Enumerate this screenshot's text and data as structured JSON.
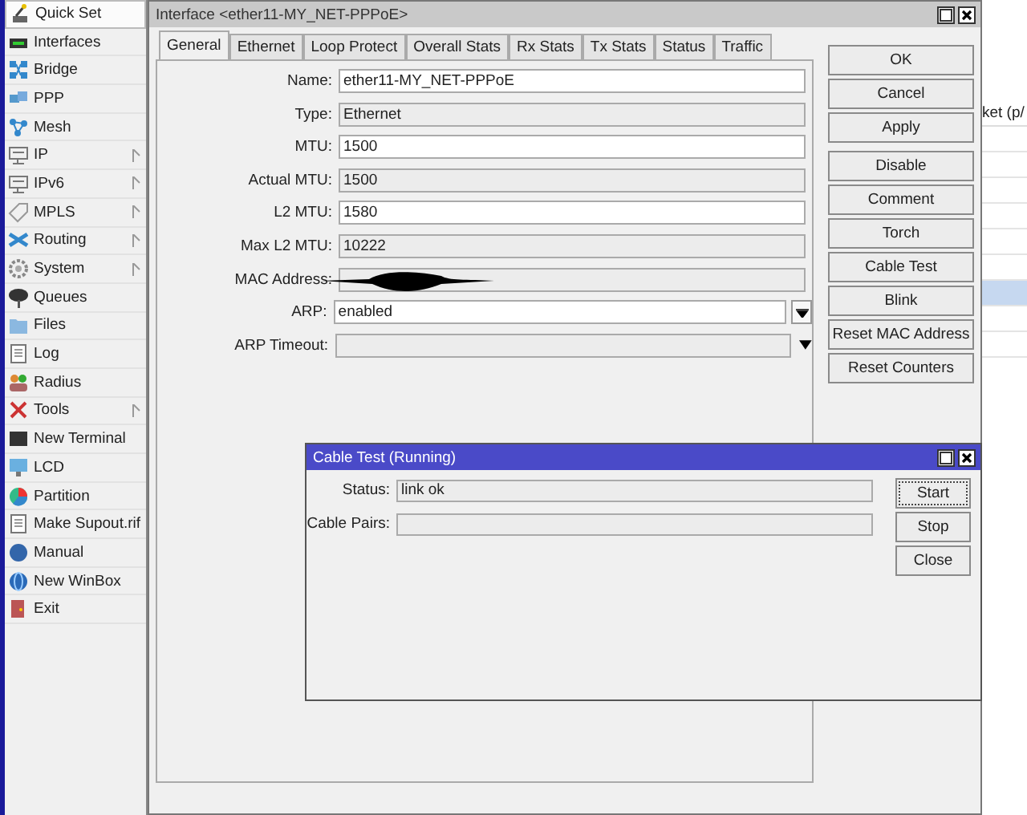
{
  "sidebar": {
    "items": [
      {
        "label": "Quick Set",
        "submenu": false,
        "selected": true
      },
      {
        "label": "Interfaces",
        "submenu": false,
        "selected": false
      },
      {
        "label": "Bridge",
        "submenu": false,
        "selected": false
      },
      {
        "label": "PPP",
        "submenu": false,
        "selected": false
      },
      {
        "label": "Mesh",
        "submenu": false,
        "selected": false
      },
      {
        "label": "IP",
        "submenu": true,
        "selected": false
      },
      {
        "label": "IPv6",
        "submenu": true,
        "selected": false
      },
      {
        "label": "MPLS",
        "submenu": true,
        "selected": false
      },
      {
        "label": "Routing",
        "submenu": true,
        "selected": false
      },
      {
        "label": "System",
        "submenu": true,
        "selected": false
      },
      {
        "label": "Queues",
        "submenu": false,
        "selected": false
      },
      {
        "label": "Files",
        "submenu": false,
        "selected": false
      },
      {
        "label": "Log",
        "submenu": false,
        "selected": false
      },
      {
        "label": "Radius",
        "submenu": false,
        "selected": false
      },
      {
        "label": "Tools",
        "submenu": true,
        "selected": false
      },
      {
        "label": "New Terminal",
        "submenu": false,
        "selected": false
      },
      {
        "label": "LCD",
        "submenu": false,
        "selected": false
      },
      {
        "label": "Partition",
        "submenu": false,
        "selected": false
      },
      {
        "label": "Make Supout.rif",
        "submenu": false,
        "selected": false
      },
      {
        "label": "Manual",
        "submenu": false,
        "selected": false
      },
      {
        "label": "New WinBox",
        "submenu": false,
        "selected": false
      },
      {
        "label": "Exit",
        "submenu": false,
        "selected": false
      }
    ]
  },
  "background_list": {
    "column_header": "ket (p/",
    "rows": [
      {
        "selected": false
      },
      {
        "selected": false
      },
      {
        "selected": false
      },
      {
        "selected": false
      },
      {
        "selected": false
      },
      {
        "selected": false
      },
      {
        "selected": true
      },
      {
        "selected": false
      },
      {
        "selected": false
      }
    ]
  },
  "interface_window": {
    "title": "Interface <ether11-MY_NET-PPPoE>",
    "tabs": [
      {
        "label": "General",
        "selected": true
      },
      {
        "label": "Ethernet",
        "selected": false
      },
      {
        "label": "Loop Protect",
        "selected": false
      },
      {
        "label": "Overall Stats",
        "selected": false
      },
      {
        "label": "Rx Stats",
        "selected": false
      },
      {
        "label": "Tx Stats",
        "selected": false
      },
      {
        "label": "Status",
        "selected": false
      },
      {
        "label": "Traffic",
        "selected": false
      }
    ],
    "fields": [
      {
        "label": "Name:",
        "value": "ether11-MY_NET-PPPoE",
        "kind": "input"
      },
      {
        "label": "Type:",
        "value": "Ethernet",
        "kind": "readonly"
      },
      {
        "label": "MTU:",
        "value": "1500",
        "kind": "input"
      },
      {
        "label": "Actual MTU:",
        "value": "1500",
        "kind": "readonly"
      },
      {
        "label": "L2 MTU:",
        "value": "1580",
        "kind": "input"
      },
      {
        "label": "Max L2 MTU:",
        "value": "10222",
        "kind": "readonly"
      },
      {
        "label": "MAC Address:",
        "kind": "redacted"
      },
      {
        "label": "ARP:",
        "value": "enabled",
        "kind": "dropdown"
      },
      {
        "label": "ARP Timeout:",
        "kind": "combo"
      }
    ],
    "button_groups": [
      [
        "OK",
        "Cancel",
        "Apply"
      ],
      [
        "Disable",
        "Comment",
        "Torch",
        "Cable Test",
        "Blink",
        "Reset MAC Address",
        "Reset Counters"
      ]
    ]
  },
  "cable_test_dialog": {
    "title": "Cable Test (Running)",
    "fields": [
      {
        "label": "Status:",
        "value": "link ok"
      },
      {
        "label": "Cable Pairs:"
      }
    ],
    "buttons": [
      {
        "label": "Start",
        "focused": true
      },
      {
        "label": "Stop",
        "focused": false
      },
      {
        "label": "Close",
        "focused": false
      }
    ]
  }
}
